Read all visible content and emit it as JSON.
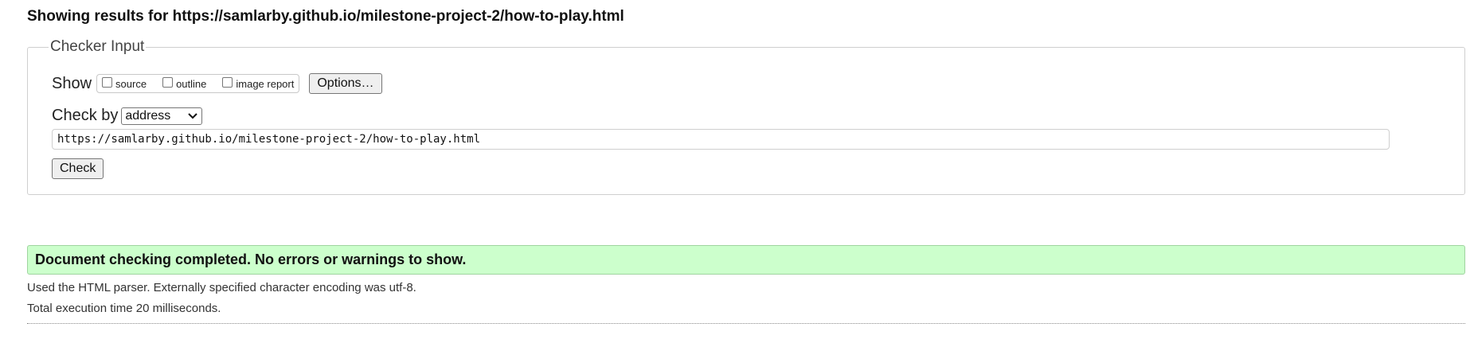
{
  "results_heading": "Showing results for https://samlarby.github.io/milestone-project-2/how-to-play.html",
  "checker": {
    "legend": "Checker Input",
    "show_label": "Show",
    "show_options": [
      {
        "label": "source",
        "checked": false
      },
      {
        "label": "outline",
        "checked": false
      },
      {
        "label": "image report",
        "checked": false
      }
    ],
    "options_button": "Options…",
    "check_by_label": "Check by",
    "check_by_value": "address",
    "url_value": "https://samlarby.github.io/milestone-project-2/how-to-play.html",
    "check_button": "Check"
  },
  "result": {
    "message": "Document checking completed. No errors or warnings to show.",
    "parser_info": "Used the HTML parser. Externally specified character encoding was utf-8.",
    "execution_time": "Total execution time 20 milliseconds."
  },
  "colors": {
    "success_background": "#ccffcc",
    "success_border": "#9fd49f"
  },
  "icons": {
    "select_arrow": "chevron-down-icon"
  }
}
